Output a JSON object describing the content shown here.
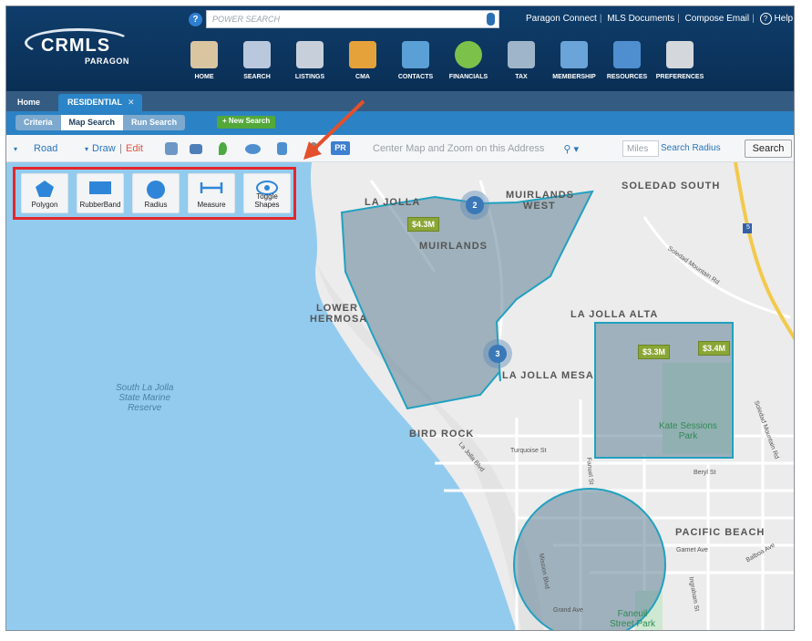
{
  "header": {
    "logo_text": "CRMLS",
    "logo_sub": "PARAGON",
    "help_glyph": "?",
    "power_search_placeholder": "POWER SEARCH",
    "links": [
      "Paragon Connect",
      "MLS Documents",
      "Compose Email",
      "Help"
    ]
  },
  "nav": [
    {
      "label": "HOME",
      "icon": "home-icon",
      "color": "#d9c5a0"
    },
    {
      "label": "SEARCH",
      "icon": "search-doc-icon",
      "color": "#b9c8dc"
    },
    {
      "label": "LISTINGS",
      "icon": "listings-icon",
      "color": "#c7d0da"
    },
    {
      "label": "CMA",
      "icon": "cma-icon",
      "color": "#e5a23b"
    },
    {
      "label": "CONTACTS",
      "icon": "contacts-icon",
      "color": "#5aa0d6"
    },
    {
      "label": "FINANCIALS",
      "icon": "financials-icon",
      "color": "#7cc24a"
    },
    {
      "label": "TAX",
      "icon": "tax-icon",
      "color": "#9fb5c9"
    },
    {
      "label": "MEMBERSHIP",
      "icon": "membership-icon",
      "color": "#6aa4d8"
    },
    {
      "label": "RESOURCES",
      "icon": "resources-icon",
      "color": "#4f8fd0"
    },
    {
      "label": "PREFERENCES",
      "icon": "preferences-icon",
      "color": "#d4d7db"
    }
  ],
  "tabs": {
    "home": "Home",
    "residential": "RESIDENTIAL",
    "close_glyph": "✕"
  },
  "subnav": {
    "criteria": "Criteria",
    "map_search": "Map Search",
    "run_search": "Run Search",
    "new_search": "+ New Search"
  },
  "toolbar": {
    "road": "Road",
    "draw": "Draw",
    "edit": "Edit",
    "pr": "PR",
    "address_placeholder": "Center Map and Zoom on this Address",
    "miles_placeholder": "Miles",
    "search_radius": "Search Radius",
    "search": "Search"
  },
  "draw_tools": [
    {
      "label": "Polygon",
      "icon": "polygon-icon"
    },
    {
      "label": "RubberBand",
      "icon": "rectangle-icon"
    },
    {
      "label": "Radius",
      "icon": "circle-icon"
    },
    {
      "label": "Measure",
      "icon": "measure-icon"
    },
    {
      "label": "Toggle Shapes",
      "icon": "eye-icon"
    }
  ],
  "map": {
    "neighborhoods": [
      "SOLEDAD SOUTH",
      "LA JOLLA",
      "MUIRLANDS WEST",
      "MUIRLANDS",
      "LOWER",
      "HERMOSA",
      "LA JOLLA ALTA",
      "LA JOLLA MESA",
      "BIRD ROCK",
      "PACIFIC BEACH"
    ],
    "water_label": [
      "South La Jolla",
      "State Marine",
      "Reserve"
    ],
    "park_labels": {
      "kate": [
        "Kate Sessions",
        "Park"
      ],
      "faneuil": [
        "Faneuil",
        "Street Park"
      ]
    },
    "streets": [
      "Soledad Mountain Rd",
      "Turquoise St",
      "La Jolla Blvd",
      "Beryl St",
      "Garnet Ave",
      "Grand Ave",
      "Mission Blvd",
      "Ingraham St",
      "Balboa Ave",
      "Soledad Mountain Rd",
      "Fanuel St"
    ],
    "prices": [
      "$4.3M",
      "$3.3M",
      "$3.4M"
    ],
    "clusters": [
      "2",
      "3"
    ],
    "highway_shield": "5"
  }
}
